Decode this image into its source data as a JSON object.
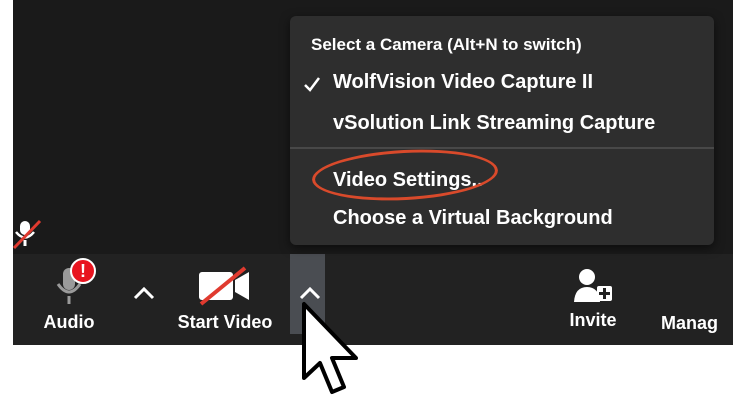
{
  "camera_menu": {
    "header": "Select a Camera (Alt+N to switch)",
    "cameras": [
      {
        "label": "WolfVision Video Capture II",
        "selected": true
      },
      {
        "label": "vSolution Link Streaming Capture",
        "selected": false
      }
    ],
    "video_settings_label": "Video Settings..",
    "virtual_background_label": "Choose a Virtual Background"
  },
  "toolbar": {
    "audio_label": "Audio",
    "audio_alert": "!",
    "start_video_label": "Start Video",
    "invite_label": "Invite",
    "manage_label": "Manag"
  },
  "colors": {
    "menu_bg": "#2e2e2e",
    "toolbar_bg": "#222222",
    "meeting_bg": "#1a1a1a",
    "alert_red": "#e8141f",
    "annotation_red": "#d94a2b",
    "muted_slash": "#e03a2f"
  },
  "icons": {
    "muted_indicator": "muted-mic-icon",
    "audio": "microphone-icon",
    "start_video": "video-off-icon",
    "invite": "add-user-icon",
    "check": "checkmark-icon",
    "cursor": "mouse-pointer-icon"
  }
}
